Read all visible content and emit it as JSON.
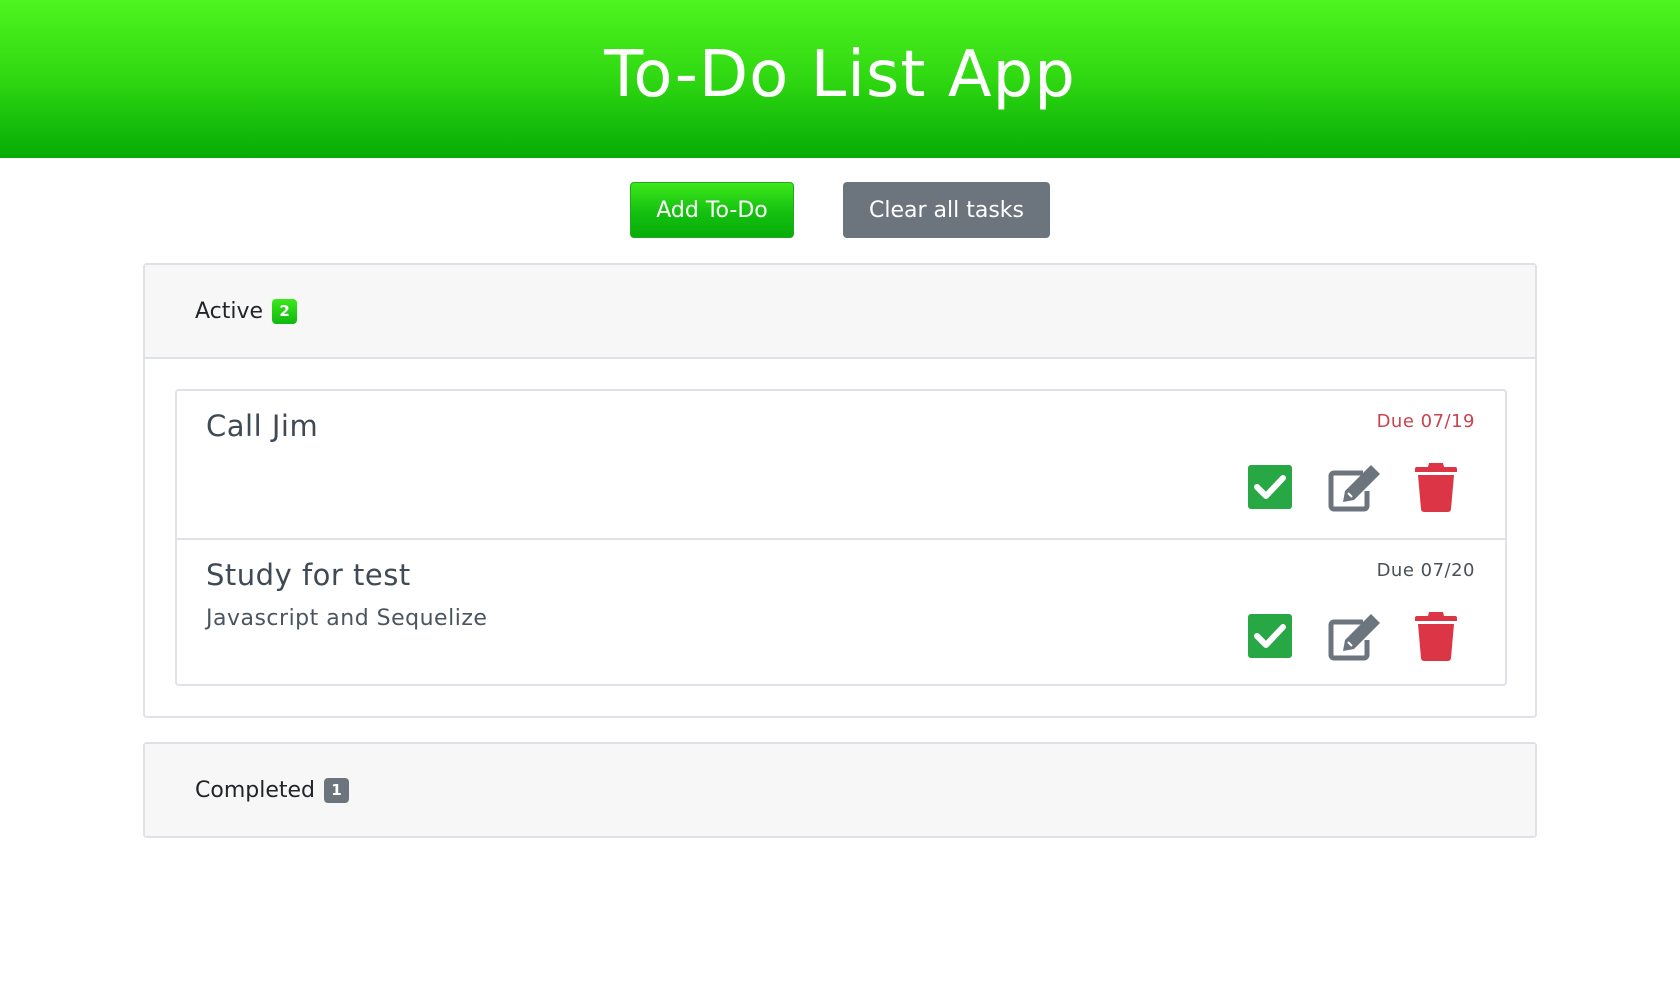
{
  "app": {
    "title": "To-Do List App"
  },
  "toolbar": {
    "add_label": "Add To-Do",
    "clear_label": "Clear all tasks"
  },
  "active": {
    "label": "Active",
    "count": "2",
    "tasks": [
      {
        "title": "Call Jim",
        "description": "",
        "due": "Due 07/19",
        "overdue": true
      },
      {
        "title": "Study for test",
        "description": "Javascript and Sequelize",
        "due": "Due 07/20",
        "overdue": false
      }
    ]
  },
  "completed": {
    "label": "Completed",
    "count": "1"
  },
  "colors": {
    "check": "#28a745",
    "edit": "#6c757d",
    "delete": "#dc3545",
    "due_overdue": "#dc3545",
    "due_normal": "#495057"
  },
  "icons": {
    "complete": "check-square-icon",
    "edit": "edit-icon",
    "delete": "trash-icon"
  }
}
